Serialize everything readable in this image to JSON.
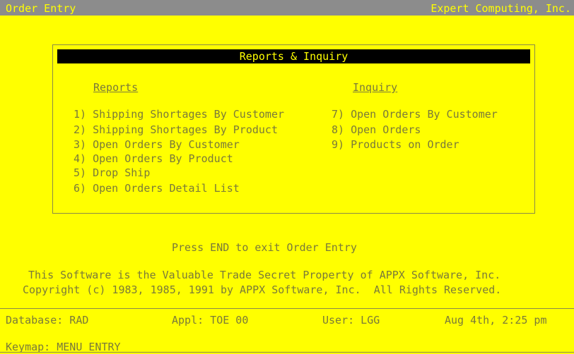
{
  "titlebar": {
    "app_title": "Order Entry",
    "company": "Expert Computing, Inc."
  },
  "panel": {
    "title": "Reports & Inquiry",
    "reports_header": "Reports",
    "inquiry_header": "Inquiry",
    "reports": [
      "1) Shipping Shortages By Customer",
      "2) Shipping Shortages By Product",
      "3) Open Orders By Customer",
      "4) Open Orders By Product",
      "5) Drop Ship",
      "6) Open Orders Detail List"
    ],
    "inquiry": [
      "7) Open Orders By Customer",
      "8) Open Orders",
      "9) Products on Order"
    ]
  },
  "exit_hint": "Press END to exit Order Entry",
  "legal": {
    "line1": "This Software is the Valuable Trade Secret Property of APPX Software, Inc.",
    "line2": "Copyright (c) 1983, 1985, 1991 by APPX Software, Inc.  All Rights Reserved."
  },
  "status": {
    "database": "Database: RAD",
    "appl": "Appl: TOE 00",
    "user": "User: LGG",
    "datetime": "Aug 4th, 2:25 pm"
  },
  "keymap": "Keymap: MENU ENTRY",
  "colors": {
    "background": "#ffff00",
    "text": "#7a7a3a",
    "titlebar": "#8c8c8c",
    "panel_header": "#000000"
  }
}
